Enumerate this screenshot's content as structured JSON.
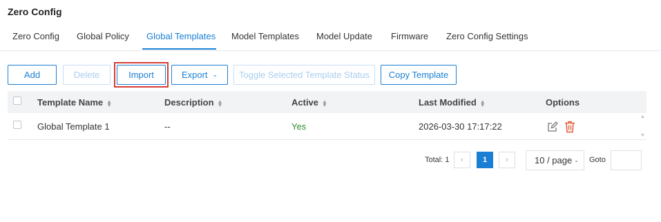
{
  "page": {
    "title": "Zero Config"
  },
  "tabs": [
    {
      "label": "Zero Config"
    },
    {
      "label": "Global Policy"
    },
    {
      "label": "Global Templates",
      "active": true
    },
    {
      "label": "Model Templates"
    },
    {
      "label": "Model Update"
    },
    {
      "label": "Firmware"
    },
    {
      "label": "Zero Config Settings"
    }
  ],
  "toolbar": {
    "add": "Add",
    "delete": "Delete",
    "import": "Import",
    "export": "Export",
    "toggle": "Toggle Selected Template Status",
    "copy": "Copy Template"
  },
  "table": {
    "headers": {
      "name": "Template Name",
      "description": "Description",
      "active": "Active",
      "modified": "Last Modified",
      "options": "Options"
    },
    "rows": [
      {
        "name": "Global Template 1",
        "description": "--",
        "active": "Yes",
        "modified": "2026-03-30 17:17:22"
      }
    ]
  },
  "pagination": {
    "total": "Total: 1",
    "current_page": "1",
    "prev": "‹",
    "next": "›",
    "page_size": "10 / page",
    "goto_label": "Goto"
  },
  "colors": {
    "accent": "#1a7fd4",
    "highlight": "#d63b33",
    "active_yes": "#2e8b2e",
    "delete_icon": "#e05a3a"
  },
  "icons": {
    "edit": "edit-icon",
    "delete": "trash-icon",
    "sort": "sort-icon",
    "dropdown": "chevron-down-icon"
  }
}
